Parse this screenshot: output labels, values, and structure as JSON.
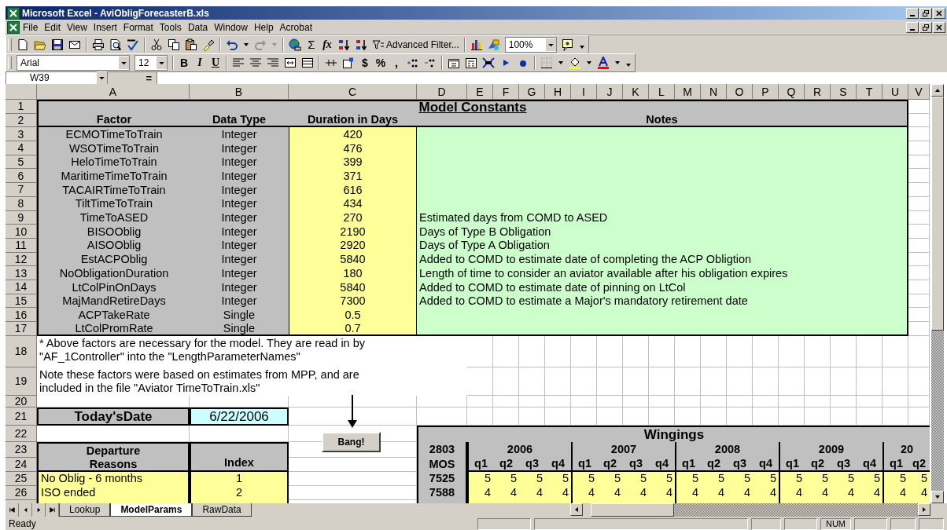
{
  "window": {
    "title": "Microsoft Excel - AviObligForecasterB.xls"
  },
  "menu": [
    "File",
    "Edit",
    "View",
    "Insert",
    "Format",
    "Tools",
    "Data",
    "Window",
    "Help",
    "Acrobat"
  ],
  "toolbar": {
    "sum": "Σ",
    "function": "fx",
    "advanced_filter": "Advanced Filter...",
    "zoom": "100%",
    "font": "Arial",
    "font_size": "12",
    "bold": "B",
    "italic": "I",
    "underline": "U",
    "currency": "$",
    "percent": "%",
    "comma": ","
  },
  "formula_bar": {
    "name_box": "W39",
    "equals": "="
  },
  "column_headers": [
    "A",
    "B",
    "C",
    "D",
    "E",
    "F",
    "G",
    "H",
    "I",
    "J",
    "K",
    "L",
    "M",
    "N",
    "O",
    "P",
    "Q",
    "R",
    "S",
    "T",
    "U",
    "V"
  ],
  "row_headers": [
    "1",
    "2",
    "3",
    "4",
    "5",
    "6",
    "7",
    "8",
    "9",
    "10",
    "11",
    "12",
    "13",
    "14",
    "15",
    "16",
    "17",
    "18",
    "19",
    "20",
    "21",
    "22",
    "23",
    "24",
    "25",
    "26"
  ],
  "model_constants": {
    "title": "Model Constants",
    "headers": [
      "Factor",
      "Data Type",
      "Duration in Days",
      "Notes"
    ],
    "rows": [
      {
        "factor": "ECMOTimeToTrain",
        "data_type": "Integer",
        "duration": "420"
      },
      {
        "factor": "WSOTimeToTrain",
        "data_type": "Integer",
        "duration": "476"
      },
      {
        "factor": "HeloTimeToTrain",
        "data_type": "Integer",
        "duration": "399"
      },
      {
        "factor": "MaritimeTimeToTrain",
        "data_type": "Integer",
        "duration": "371"
      },
      {
        "factor": "TACAIRTimeToTrain",
        "data_type": "Integer",
        "duration": "616"
      },
      {
        "factor": "TiltTimeToTrain",
        "data_type": "Integer",
        "duration": "434"
      },
      {
        "factor": "TimeToASED",
        "data_type": "Integer",
        "duration": "270",
        "note": "Estimated days from COMD to ASED"
      },
      {
        "factor": "BISOOblig",
        "data_type": "Integer",
        "duration": "2190",
        "note": "Days of Type B Obligation"
      },
      {
        "factor": "AISOOblig",
        "data_type": "Integer",
        "duration": "2920",
        "note": "Days of Type A Obligation"
      },
      {
        "factor": "EstACPOblig",
        "data_type": "Integer",
        "duration": "5840",
        "note": "Added to COMD to estimate date of completing the ACP Obligtion"
      },
      {
        "factor": "NoObligationDuration",
        "data_type": "Integer",
        "duration": "180",
        "note": "Length of time to consider an aviator available after his obligation expires"
      },
      {
        "factor": "LtColPinOnDays",
        "data_type": "Integer",
        "duration": "5840",
        "note": "Added to COMD to estimate date of pinning on LtCol"
      },
      {
        "factor": "MajMandRetireDays",
        "data_type": "Integer",
        "duration": "7300",
        "note": "Added to COMD to estimate a Major's mandatory retirement date"
      },
      {
        "factor": "ACPTakeRate",
        "data_type": "Single",
        "duration": "0.5"
      },
      {
        "factor": "LtColPromRate",
        "data_type": "Single",
        "duration": "0.7"
      }
    ]
  },
  "footnotes": [
    {
      "lines": [
        "* Above factors are necessary for the model.  They are read in by",
        "\"AF_1Controller\" into the \"LengthParameterNames\""
      ]
    },
    {
      "lines": [
        "Note these factors were based on estimates from MPP, and are",
        "included in the file \"Aviator TimeToTrain.xls\""
      ]
    }
  ],
  "todays_date": {
    "label": "Today'sDate",
    "value": "6/22/2006"
  },
  "macro_button": {
    "label": "Bang!"
  },
  "departure_reasons": {
    "header_lines": [
      "Departure",
      "Reasons"
    ],
    "index_header": "Index",
    "rows": [
      {
        "reason": "No Oblig - 6 months",
        "index": "1"
      },
      {
        "reason": "ISO ended",
        "index": "2"
      }
    ]
  },
  "wingings": {
    "title": "Wingings",
    "corner": [
      "2803",
      "MOS"
    ],
    "years": [
      {
        "label": "2006",
        "quarters": [
          "q1",
          "q2",
          "q3",
          "q4"
        ]
      },
      {
        "label": "2007",
        "quarters": [
          "q1",
          "q2",
          "q3",
          "q4"
        ]
      },
      {
        "label": "2008",
        "quarters": [
          "q1",
          "q2",
          "q3",
          "q4"
        ]
      },
      {
        "label": "2009",
        "quarters": [
          "q1",
          "q2",
          "q3",
          "q4"
        ]
      },
      {
        "label": "20",
        "quarters": [
          "q1",
          "q2"
        ]
      }
    ],
    "rows": [
      {
        "mos": "7525",
        "values": [
          "5",
          "5",
          "5",
          "5",
          "5",
          "5",
          "5",
          "5",
          "5",
          "5",
          "5",
          "5",
          "5",
          "5",
          "5",
          "5",
          "5",
          "5"
        ]
      },
      {
        "mos": "7588",
        "values": [
          "4",
          "4",
          "4",
          "4",
          "4",
          "4",
          "4",
          "4",
          "4",
          "4",
          "4",
          "4",
          "4",
          "4",
          "4",
          "4",
          "4",
          "4"
        ]
      }
    ]
  },
  "sheet_tabs": [
    {
      "label": "Lookup",
      "selected": false
    },
    {
      "label": "ModelParams",
      "selected": true
    },
    {
      "label": "RawData",
      "selected": false
    }
  ],
  "status_bar": {
    "text": "Ready",
    "indicators": [
      "NUM"
    ]
  }
}
